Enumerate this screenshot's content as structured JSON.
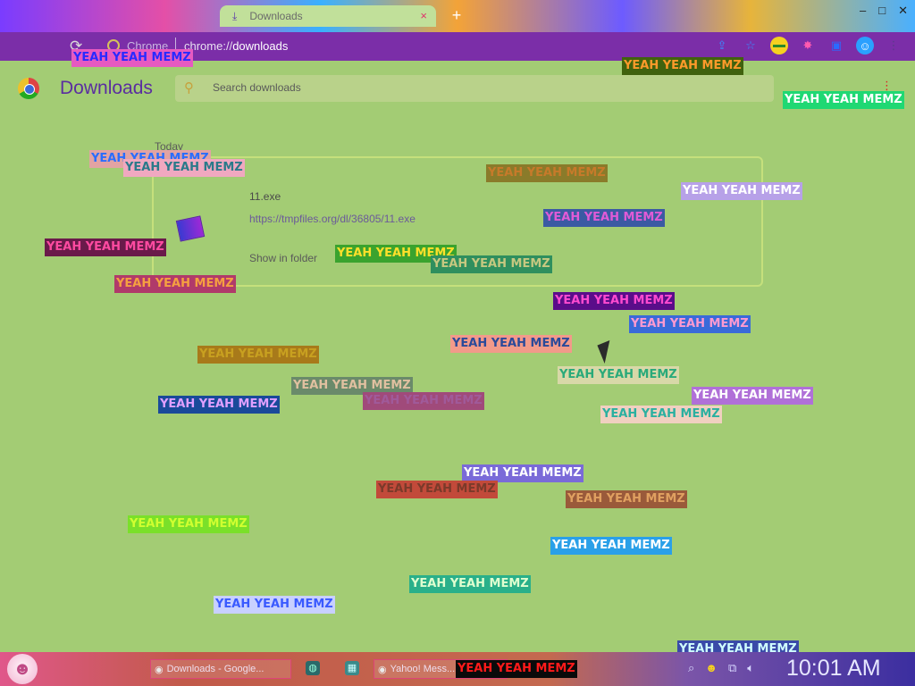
{
  "browser": {
    "tab": {
      "title": "Downloads",
      "close_glyph": "×"
    },
    "newtab_glyph": "+",
    "window_buttons": [
      "–",
      "□",
      "✕"
    ],
    "address": {
      "site_label": "Chrome",
      "url_prefix": "chrome://",
      "url_path": "downloads"
    },
    "toolbar_icons": [
      "share-icon",
      "star-icon",
      "tab-search-icon",
      "extensions-icon",
      "side-panel-icon",
      "profile-icon",
      "menu-icon"
    ]
  },
  "downloads": {
    "title": "Downloads",
    "search_placeholder": "Search downloads",
    "menu_glyph": "⋮",
    "date_heading": "Today",
    "item": {
      "filename": "11.exe",
      "url": "https://tmpfiles.org/dl/36805/11.exe",
      "action": "Show in folder"
    }
  },
  "overlay": {
    "text": "YEAH YEAH MEMZ",
    "color_pairs": [
      [
        "#e65ac1",
        "#2a2aff"
      ],
      [
        "#40620e",
        "#ff9a2a"
      ],
      [
        "#1fd873",
        "#ffffff"
      ],
      [
        "#e2a3a3",
        "#2a6dff"
      ],
      [
        "#f0a8c0",
        "#2a7a8a"
      ],
      [
        "#8a7b2a",
        "#c77a2a"
      ],
      [
        "#b7a1e8",
        "#ffffff"
      ],
      [
        "#3b5aa3",
        "#e05ad6"
      ],
      [
        "#6a1a4a",
        "#ff4aa0"
      ],
      [
        "#3aa32e",
        "#ffe02a"
      ],
      [
        "#2f8f5e",
        "#c6c880"
      ],
      [
        "#b03a6a",
        "#f5a040"
      ],
      [
        "#5a0d8a",
        "#ff4ad0"
      ],
      [
        "#3a6ad9",
        "#ff9ad0"
      ],
      [
        "#f29a8a",
        "#2a4a9a"
      ],
      [
        "#a87a1a",
        "#c8a020"
      ],
      [
        "#d8d8a8",
        "#2aaa7a"
      ],
      [
        "#1a4a9a",
        "#e0a0ff"
      ],
      [
        "#6a8a6a",
        "#e0c0a0"
      ],
      [
        "#a04a7a",
        "#a05a9a"
      ],
      [
        "#b070d8",
        "#ffffff"
      ],
      [
        "#f0d0c0",
        "#2ab0a0"
      ],
      [
        "#7a6ad8",
        "#ffffff"
      ],
      [
        "#2a8ac8",
        "#ffd0ff"
      ],
      [
        "#c24a3a",
        "#7a3a2a"
      ],
      [
        "#9a5a3a",
        "#e0a060"
      ],
      [
        "#7ae02a",
        "#d0ff30"
      ],
      [
        "#2aa0e8",
        "#ffffff"
      ],
      [
        "#2ab08a",
        "#e0ffd0"
      ],
      [
        "#c8d0ff",
        "#3a5aff"
      ],
      [
        "#0a0a0a",
        "#ff1a1a"
      ],
      [
        "#3a4aa8",
        "#d0ffff"
      ]
    ]
  },
  "taskbar": {
    "start_glyph": "☻",
    "items": [
      "Downloads - Google...",
      "Yahoo! Mess..."
    ],
    "tray_icons": [
      "search-icon",
      "smiley-icon",
      "network-icon",
      "volume-icon"
    ],
    "clock": "10:01 AM"
  }
}
